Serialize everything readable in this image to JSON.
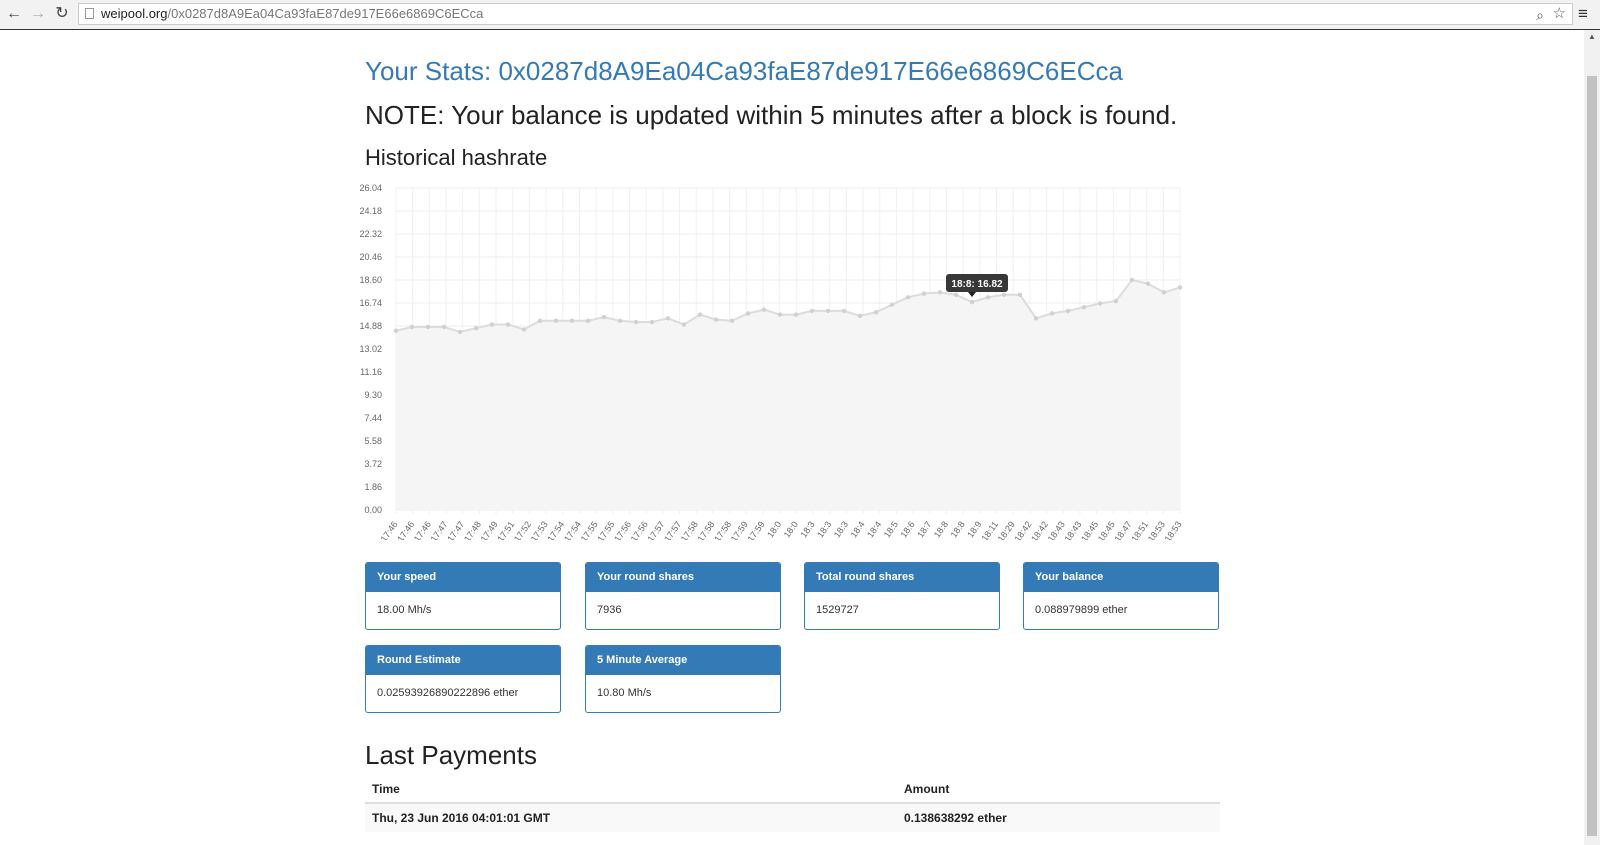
{
  "browser": {
    "url_host": "weipool.org",
    "url_path": "/0x0287d8A9Ea04Ca93faE87de917E66e6869C6ECca",
    "back_glyph": "←",
    "forward_glyph": "→",
    "reload_glyph": "↻",
    "zoom_glyph": "⌕",
    "star_glyph": "☆",
    "menu_glyph": "≡"
  },
  "page": {
    "title": "Your Stats: 0x0287d8A9Ea04Ca93faE87de917E66e6869C6ECca",
    "note": "NOTE: Your balance is updated within 5 minutes after a block is found.",
    "chart_heading": "Historical hashrate",
    "payments_heading": "Last Payments"
  },
  "chart_data": {
    "type": "area",
    "title": "",
    "xlabel": "",
    "ylabel": "",
    "ylim": [
      0,
      26.04
    ],
    "yticks": [
      "26.04",
      "24.18",
      "22.32",
      "20.46",
      "18.60",
      "16.74",
      "14.88",
      "13.02",
      "11.16",
      "9.30",
      "7.44",
      "5.58",
      "3.72",
      "1.86",
      "0.00"
    ],
    "grid": true,
    "x": [
      "17:46",
      "17:46",
      "17:46",
      "17:47",
      "17:47",
      "17:48",
      "17:49",
      "17:51",
      "17:52",
      "17:53",
      "17:54",
      "17:54",
      "17:55",
      "17:55",
      "17:56",
      "17:56",
      "17:57",
      "17:57",
      "17:58",
      "17:58",
      "17:58",
      "17:59",
      "17:59",
      "18:0",
      "18:0",
      "18:3",
      "18:3",
      "18:3",
      "18:4",
      "18:4",
      "18:5",
      "18:6",
      "18:7",
      "18:8",
      "18:8",
      "18:9",
      "18:11",
      "18:29",
      "18:42",
      "18:42",
      "18:43",
      "18:43",
      "18:45",
      "18:45",
      "18:47",
      "18:51",
      "18:53",
      "18:53"
    ],
    "series": [
      {
        "values": [
          14.5,
          14.8,
          14.8,
          14.8,
          14.4,
          14.7,
          15.0,
          15.0,
          14.6,
          15.3,
          15.3,
          15.3,
          15.3,
          15.6,
          15.3,
          15.2,
          15.2,
          15.5,
          15.0,
          15.8,
          15.4,
          15.3,
          15.9,
          16.2,
          15.8,
          15.8,
          16.1,
          16.1,
          16.1,
          15.7,
          16.0,
          16.6,
          17.2,
          17.5,
          17.6,
          17.4,
          16.82,
          17.2,
          17.4,
          17.4,
          15.5,
          15.9,
          16.1,
          16.4,
          16.7,
          16.9,
          18.6,
          18.3,
          17.6,
          18.0
        ]
      }
    ],
    "tooltip": {
      "label": "18:8",
      "value": "16.82"
    }
  },
  "cards": [
    {
      "label": "Your speed",
      "value": "18.00 Mh/s"
    },
    {
      "label": "Your round shares",
      "value": "7936"
    },
    {
      "label": "Total round shares",
      "value": "1529727"
    },
    {
      "label": "Your balance",
      "value": "0.088979899 ether"
    },
    {
      "label": "Round Estimate",
      "value": "0.02593926890222896 ether"
    },
    {
      "label": "5 Minute Average",
      "value": "10.80 Mh/s"
    }
  ],
  "payments": {
    "columns": [
      "Time",
      "Amount"
    ],
    "rows": [
      {
        "time": "Thu, 23 Jun 2016 04:01:01 GMT",
        "amount": "0.138638292 ether"
      }
    ]
  },
  "colors": {
    "accent": "#337ab7",
    "line": "#dcdcdc",
    "point": "#d0d0d0",
    "fill": "#f5f5f5"
  }
}
